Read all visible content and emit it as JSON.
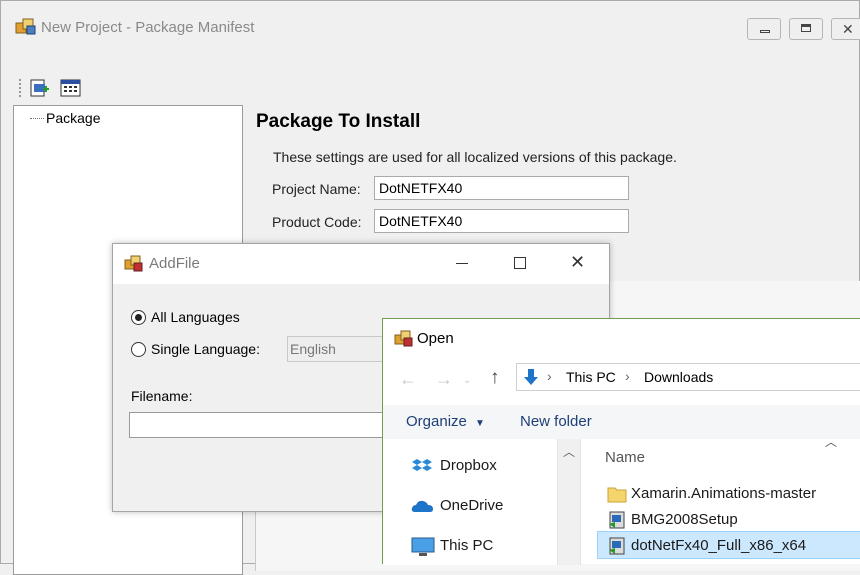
{
  "main_window": {
    "title": "New Project - Package Manifest",
    "tree": {
      "item": "Package"
    },
    "content": {
      "heading": "Package To Install",
      "description": "These settings are used for all localized versions of this package.",
      "project_name_label": "Project Name:",
      "project_name_value": "DotNETFX40",
      "product_code_label": "Product Code:",
      "product_code_value": "DotNETFX40"
    }
  },
  "addfile_dialog": {
    "title": "AddFile",
    "all_languages_label": "All Languages",
    "single_language_label": "Single Language:",
    "language_value": "English",
    "filename_label": "Filename:",
    "filename_value": "",
    "all_languages_selected": true
  },
  "open_dialog": {
    "title": "Open",
    "breadcrumb": [
      "This PC",
      "Downloads"
    ],
    "toolbar": {
      "organize_label": "Organize",
      "new_folder_label": "New folder"
    },
    "nav_items": [
      "Dropbox",
      "OneDrive",
      "This PC"
    ],
    "column_header": "Name",
    "files": [
      {
        "name": "Xamarin.Animations-master",
        "icon": "folder-icon"
      },
      {
        "name": "BMG2008Setup",
        "icon": "setup-exe-icon"
      },
      {
        "name": "dotNetFx40_Full_x86_x64",
        "icon": "setup-exe-icon",
        "selected": true
      }
    ]
  },
  "colors": {
    "selection_bg": "#cce8ff",
    "accent_blue": "#1e74c8",
    "dialog_border": "#6e9e52"
  }
}
